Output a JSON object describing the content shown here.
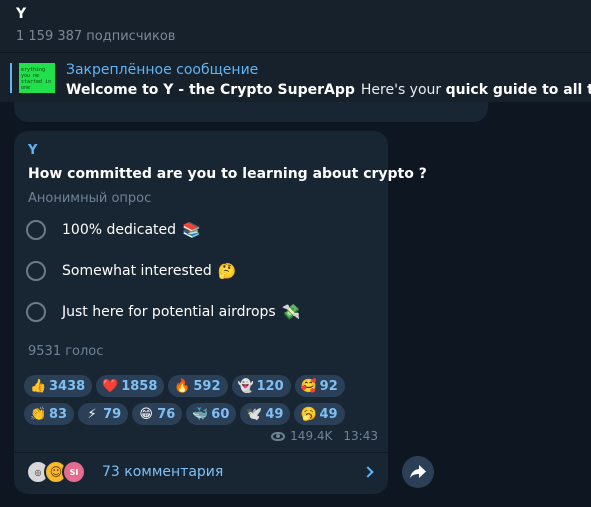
{
  "header": {
    "title": "Y",
    "subscribers": "1 159 387 подписчиков"
  },
  "pinned": {
    "label": "Закреплённое сообщение",
    "thumb_text": "erything you ne started in one",
    "text_bold": "Welcome to Y - the Crypto SuperApp",
    "text_normal": "Here's your",
    "text_bold2": "quick guide to all things Y N"
  },
  "post": {
    "author": "Y",
    "question": "How committed are you to learning about crypto ?",
    "poll_type": "Анонимный опрос",
    "options": [
      {
        "label": "100% dedicated",
        "emoji": "📚"
      },
      {
        "label": "Somewhat interested",
        "emoji": "🤔"
      },
      {
        "label": "Just here for potential airdrops",
        "emoji": "💸"
      }
    ],
    "votes": "9531 голос",
    "reactions_row1": [
      {
        "icon": "👍",
        "icon_name": "thumbs-up-icon",
        "count": "3438"
      },
      {
        "icon": "❤️",
        "icon_name": "heart-icon",
        "count": "1858"
      },
      {
        "icon": "🔥",
        "icon_name": "fire-icon",
        "count": "592"
      },
      {
        "icon": "👻",
        "icon_name": "ghost-icon",
        "count": "120"
      },
      {
        "icon": "🥰",
        "icon_name": "smiling-hearts-icon",
        "count": "92"
      }
    ],
    "reactions_row2": [
      {
        "icon": "👏",
        "icon_name": "clap-icon",
        "count": "83"
      },
      {
        "icon": "⚡",
        "icon_name": "lightning-icon",
        "count": "79"
      },
      {
        "icon": "😁",
        "icon_name": "grin-icon",
        "count": "76"
      },
      {
        "icon": "🐳",
        "icon_name": "whale-icon",
        "count": "60"
      },
      {
        "icon": "🕊️",
        "icon_name": "dove-icon",
        "count": "49"
      },
      {
        "icon": "🥱",
        "icon_name": "yawn-icon",
        "count": "49"
      }
    ],
    "views": "149.4K",
    "time": "13:43",
    "comments_label": "73 комментария",
    "avatar_initials": "SI"
  },
  "colors": {
    "background": "#0e1621",
    "bubble": "#182533",
    "accent": "#5eb5f7",
    "reaction_bg": "#2b3f56"
  }
}
